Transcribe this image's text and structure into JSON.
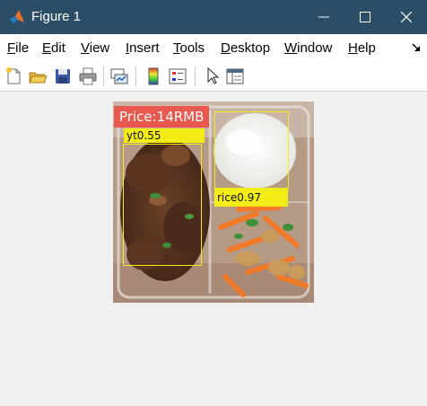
{
  "window": {
    "title": "Figure 1"
  },
  "menubar": {
    "items": [
      {
        "label": "File"
      },
      {
        "label": "Edit"
      },
      {
        "label": "View"
      },
      {
        "label": "Insert"
      },
      {
        "label": "Tools"
      },
      {
        "label": "Desktop"
      },
      {
        "label": "Window"
      },
      {
        "label": "Help"
      }
    ]
  },
  "toolbar": {
    "buttons": [
      {
        "icon": "new-figure-icon"
      },
      {
        "icon": "open-file-icon"
      },
      {
        "icon": "save-icon"
      },
      {
        "icon": "print-icon"
      },
      {
        "icon": "link-plot-icon"
      },
      {
        "icon": "colorbar-icon"
      },
      {
        "icon": "legend-icon"
      },
      {
        "icon": "pointer-icon"
      },
      {
        "icon": "property-inspector-icon"
      }
    ]
  },
  "figure": {
    "price_label": "Price:14RMB",
    "detections": [
      {
        "label": "yt0.55"
      },
      {
        "label": "rice0.97"
      }
    ]
  },
  "colors": {
    "titlebar": "#2b4d66",
    "detection_box": "#f3ea1a",
    "price_badge": "#e9584e"
  }
}
